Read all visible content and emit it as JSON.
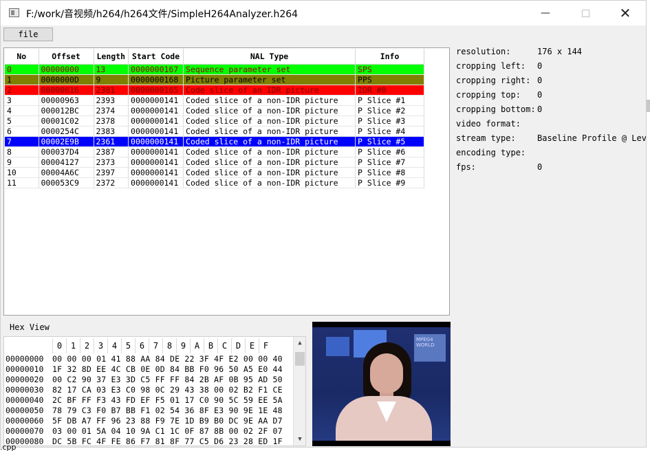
{
  "window": {
    "title": "F:/work/音视频/h264/h264文件/SimpleH264Analyzer.h264",
    "minimize_glyph": "—",
    "close_glyph": "✕"
  },
  "menu": {
    "file_label": "file"
  },
  "nal_table": {
    "headers": [
      "No",
      "Offset",
      "Length",
      "Start Code",
      "NAL Type",
      "Info"
    ],
    "rows": [
      {
        "no": "0",
        "offset": "00000000",
        "length": "13",
        "start_code": "0000000167",
        "nal_type": "Sequence parameter set",
        "info": "SPS",
        "style": "sps"
      },
      {
        "no": "1",
        "offset": "0000000D",
        "length": "9",
        "start_code": "0000000168",
        "nal_type": "Picture parameter set",
        "info": "PPS",
        "style": "pps"
      },
      {
        "no": "2",
        "offset": "00000016",
        "length": "2381",
        "start_code": "0000000165",
        "nal_type": "Code slice of an IDR picture",
        "info": "IDR #0",
        "style": "idr"
      },
      {
        "no": "3",
        "offset": "00000963",
        "length": "2393",
        "start_code": "0000000141",
        "nal_type": "Coded slice of a non-IDR picture",
        "info": "P Slice #1",
        "style": ""
      },
      {
        "no": "4",
        "offset": "000012BC",
        "length": "2374",
        "start_code": "0000000141",
        "nal_type": "Coded slice of a non-IDR picture",
        "info": "P Slice #2",
        "style": ""
      },
      {
        "no": "5",
        "offset": "00001C02",
        "length": "2378",
        "start_code": "0000000141",
        "nal_type": "Coded slice of a non-IDR picture",
        "info": "P Slice #3",
        "style": ""
      },
      {
        "no": "6",
        "offset": "0000254C",
        "length": "2383",
        "start_code": "0000000141",
        "nal_type": "Coded slice of a non-IDR picture",
        "info": "P Slice #4",
        "style": ""
      },
      {
        "no": "7",
        "offset": "00002E9B",
        "length": "2361",
        "start_code": "0000000141",
        "nal_type": "Coded slice of a non-IDR picture",
        "info": "P Slice #5",
        "style": "sel"
      },
      {
        "no": "8",
        "offset": "000037D4",
        "length": "2387",
        "start_code": "0000000141",
        "nal_type": "Coded slice of a non-IDR picture",
        "info": "P Slice #6",
        "style": ""
      },
      {
        "no": "9",
        "offset": "00004127",
        "length": "2373",
        "start_code": "0000000141",
        "nal_type": "Coded slice of a non-IDR picture",
        "info": "P Slice #7",
        "style": ""
      },
      {
        "no": "10",
        "offset": "00004A6C",
        "length": "2397",
        "start_code": "0000000141",
        "nal_type": "Coded slice of a non-IDR picture",
        "info": "P Slice #8",
        "style": ""
      },
      {
        "no": "11",
        "offset": "000053C9",
        "length": "2372",
        "start_code": "0000000141",
        "nal_type": "Coded slice of a non-IDR picture",
        "info": "P Slice #9",
        "style": ""
      }
    ]
  },
  "info": {
    "rows": [
      {
        "label": "resolution:",
        "value": "176 x 144"
      },
      {
        "label": "cropping left:",
        "value": "0"
      },
      {
        "label": "cropping right:",
        "value": "0"
      },
      {
        "label": "cropping top:",
        "value": "0"
      },
      {
        "label": "cropping bottom:",
        "value": "0"
      },
      {
        "label": "video format:",
        "value": ""
      },
      {
        "label": "stream type:",
        "value": "Baseline Profile @ Lev"
      },
      {
        "label": "encoding type:",
        "value": ""
      },
      {
        "label": "fps:",
        "value": "0"
      }
    ]
  },
  "hex_view": {
    "title": "Hex View",
    "columns": [
      "0",
      "1",
      "2",
      "3",
      "4",
      "5",
      "6",
      "7",
      "8",
      "9",
      "A",
      "B",
      "C",
      "D",
      "E",
      "F"
    ],
    "rows": [
      {
        "addr": "00000000",
        "bytes": "00 00 00 01 41 88 AA 84 DE 22 3F 4F E2 00 00 40"
      },
      {
        "addr": "00000010",
        "bytes": "1F 32 8D EE 4C CB 0E 0D 84 BB F0 96 50 A5 E0 44"
      },
      {
        "addr": "00000020",
        "bytes": "00 C2 90 37 E3 3D C5 FF FF 84 2B AF 0B 95 AD 50"
      },
      {
        "addr": "00000030",
        "bytes": "82 17 CA 03 E3 C0 98 0C 29 43 38 00 02 B2 F1 CE"
      },
      {
        "addr": "00000040",
        "bytes": "2C BF FF F3 43 FD EF F5 01 17 C0 90 5C 59 EE 5A"
      },
      {
        "addr": "00000050",
        "bytes": "78 79 C3 F0 B7 BB F1 02 54 36 8F E3 90 9E 1E 48"
      },
      {
        "addr": "00000060",
        "bytes": "5F DB A7 FF 96 23 88 F9 7E 1D B9 B0 DC 9E AA D7"
      },
      {
        "addr": "00000070",
        "bytes": "03 00 01 5A 04 10 9A C1 1C 0F 87 8B 00 02 2F 07"
      },
      {
        "addr": "00000080",
        "bytes": "DC 5B FC 4F FE 86 F7 81 8F 77 C5 D6 23 28 ED 1F"
      }
    ]
  },
  "video": {
    "logo_text": "MPEG4 WORLD"
  },
  "outside": {
    "fragment_text": ".cpp"
  },
  "colors": {
    "sps_row": "#00ff00",
    "pps_row": "#808000",
    "idr_row": "#ff0000",
    "selected_row": "#0000ff"
  }
}
